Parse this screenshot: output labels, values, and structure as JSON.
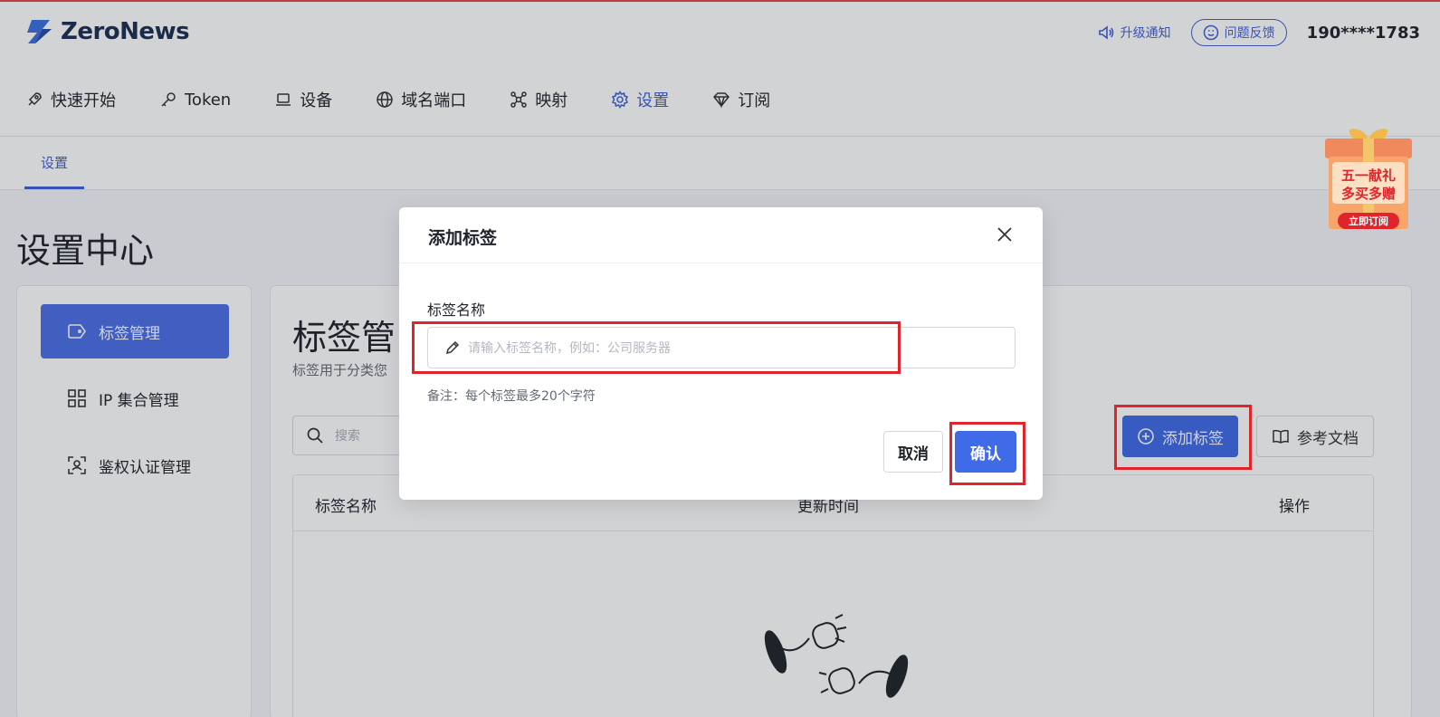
{
  "app": {
    "logo_text": "ZeroNews",
    "upgrade_notice": "升级通知",
    "feedback": "问题反馈",
    "phone": "190****1783"
  },
  "nav": [
    {
      "label": "快速开始",
      "icon": "rocket-icon"
    },
    {
      "label": "Token",
      "icon": "key-icon"
    },
    {
      "label": "设备",
      "icon": "laptop-icon"
    },
    {
      "label": "域名端口",
      "icon": "globe-icon"
    },
    {
      "label": "映射",
      "icon": "network-icon"
    },
    {
      "label": "设置",
      "icon": "gear-icon",
      "active": true
    },
    {
      "label": "订阅",
      "icon": "diamond-icon"
    }
  ],
  "subtab": "设置",
  "page_title": "设置中心",
  "sidebar": [
    {
      "label": "标签管理",
      "icon": "tag-icon",
      "active": true
    },
    {
      "label": "IP 集合管理",
      "icon": "grid-icon"
    },
    {
      "label": "鉴权认证管理",
      "icon": "face-scan-icon"
    }
  ],
  "main": {
    "title": "标签管",
    "subtitle": "标签用于分类您",
    "search_placeholder": "搜索",
    "add_button": "添加标签",
    "doc_button": "参考文档",
    "columns": [
      "标签名称",
      "更新时间",
      "操作"
    ]
  },
  "gift": {
    "line1": "五一献礼",
    "line2": "多买多赠",
    "cta": "立即订阅"
  },
  "modal": {
    "title": "添加标签",
    "field_label": "标签名称",
    "placeholder": "请输入标签名称，例如：公司服务器",
    "note": "备注：每个标签最多20个字符",
    "cancel": "取消",
    "confirm": "确认"
  },
  "colors": {
    "accent": "#3f6ae8",
    "highlight": "#e0242c"
  }
}
